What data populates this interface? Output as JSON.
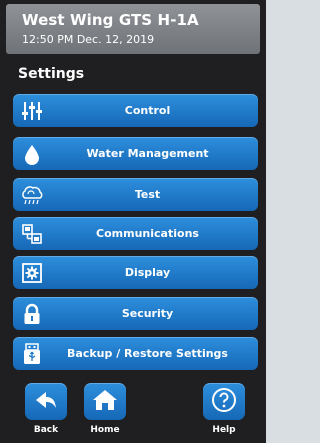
{
  "header": {
    "device_name": "West Wing GTS H-1A",
    "datetime": "12:50 PM Dec. 12, 2019"
  },
  "section_title": "Settings",
  "menu": [
    {
      "label": "Control",
      "icon": "sliders-icon"
    },
    {
      "label": "Water Management",
      "icon": "water-drop-icon"
    },
    {
      "label": "Test",
      "icon": "cloud-icon"
    },
    {
      "label": "Communications",
      "icon": "network-icon"
    },
    {
      "label": "Display",
      "icon": "display-gear-icon"
    },
    {
      "label": "Security",
      "icon": "lock-icon"
    },
    {
      "label": "Backup / Restore Settings",
      "icon": "usb-icon"
    }
  ],
  "nav": {
    "back_label": "Back",
    "home_label": "Home",
    "help_label": "Help"
  },
  "colors": {
    "button_blue": "#1e7ac9",
    "header_gray": "#7f8388",
    "background": "#1f1f21"
  }
}
